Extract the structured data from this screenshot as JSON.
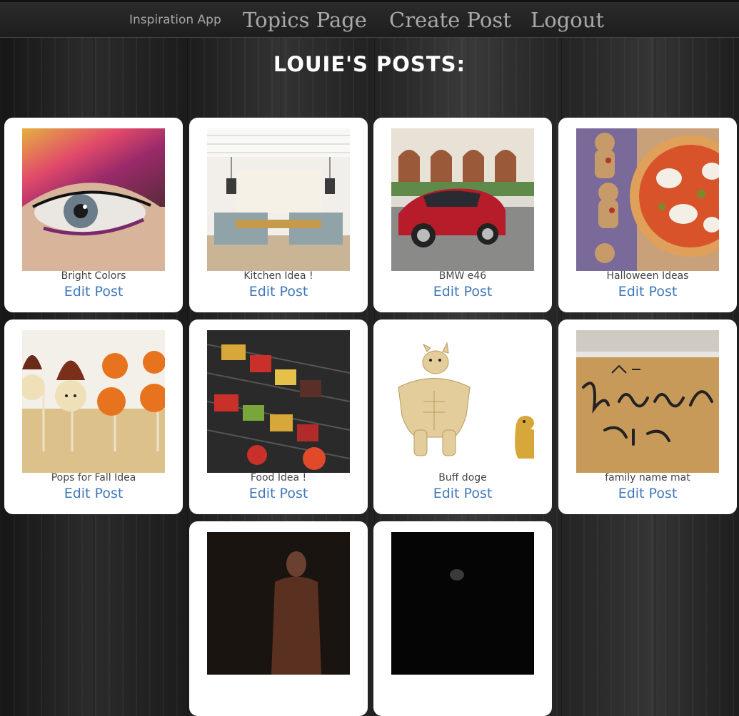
{
  "nav": {
    "brand": "Inspiration App",
    "links": [
      "Topics Page",
      "Create Post",
      "Logout"
    ]
  },
  "page": {
    "title": "LOUIE'S POSTS:"
  },
  "posts": [
    {
      "caption": "Bright Colors",
      "edit_label": "Edit Post",
      "image": "eye-makeup-photo"
    },
    {
      "caption": "Kitchen Idea !",
      "edit_label": "Edit Post",
      "image": "kitchen-photo"
    },
    {
      "caption": "BMW e46",
      "edit_label": "Edit Post",
      "image": "red-car-photo"
    },
    {
      "caption": "Halloween Ideas",
      "edit_label": "Edit Post",
      "image": "halloween-food-photo"
    },
    {
      "caption": "Pops for Fall Idea",
      "edit_label": "Edit Post",
      "image": "cake-pops-photo"
    },
    {
      "caption": "Food Idea !",
      "edit_label": "Edit Post",
      "image": "kebabs-photo"
    },
    {
      "caption": "Buff doge",
      "edit_label": "Edit Post",
      "image": "doge-meme-image"
    },
    {
      "caption": "family name mat",
      "edit_label": "Edit Post",
      "image": "doormat-photo"
    },
    {
      "caption": "",
      "edit_label": "",
      "image": "basketball-player-photo"
    },
    {
      "caption": "",
      "edit_label": "",
      "image": "dark-photo"
    }
  ],
  "colors": {
    "link": "#3f78ba",
    "nav_text": "#a9a9a9",
    "card_bg": "#ffffff"
  }
}
